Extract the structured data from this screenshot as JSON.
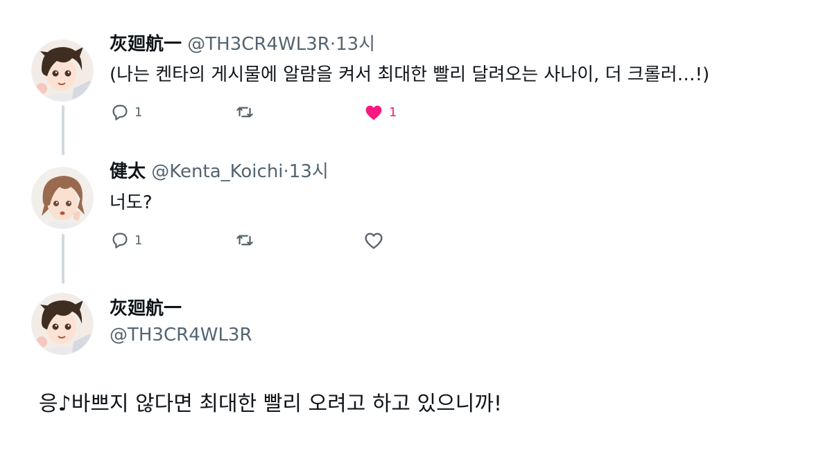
{
  "tweets": [
    {
      "name": "灰廻航一",
      "handle": "@TH3CR4WL3R",
      "dot": "·",
      "time": "13시",
      "text": "(나는 켄타의 게시물에 알람을 켜서 최대한 빨리 달려오는 사나이, 더 크롤러…!)",
      "replies": "1",
      "likes": "1",
      "liked": true
    },
    {
      "name": "健太",
      "handle": "@Kenta_Koichi",
      "dot": "·",
      "time": "13시",
      "text": "너도?",
      "replies": "1",
      "liked": false
    }
  ],
  "reply": {
    "name": "灰廻航一",
    "handle": "@TH3CR4WL3R",
    "text": "응♪바쁘지 않다면 최대한 빨리 오려고 하고 있으니까!"
  },
  "colors": {
    "like_active": "#f91880",
    "secondary_text": "#536471",
    "thread_line": "#cfd9de"
  },
  "icons": [
    "reply-icon",
    "retweet-icon",
    "like-icon"
  ]
}
